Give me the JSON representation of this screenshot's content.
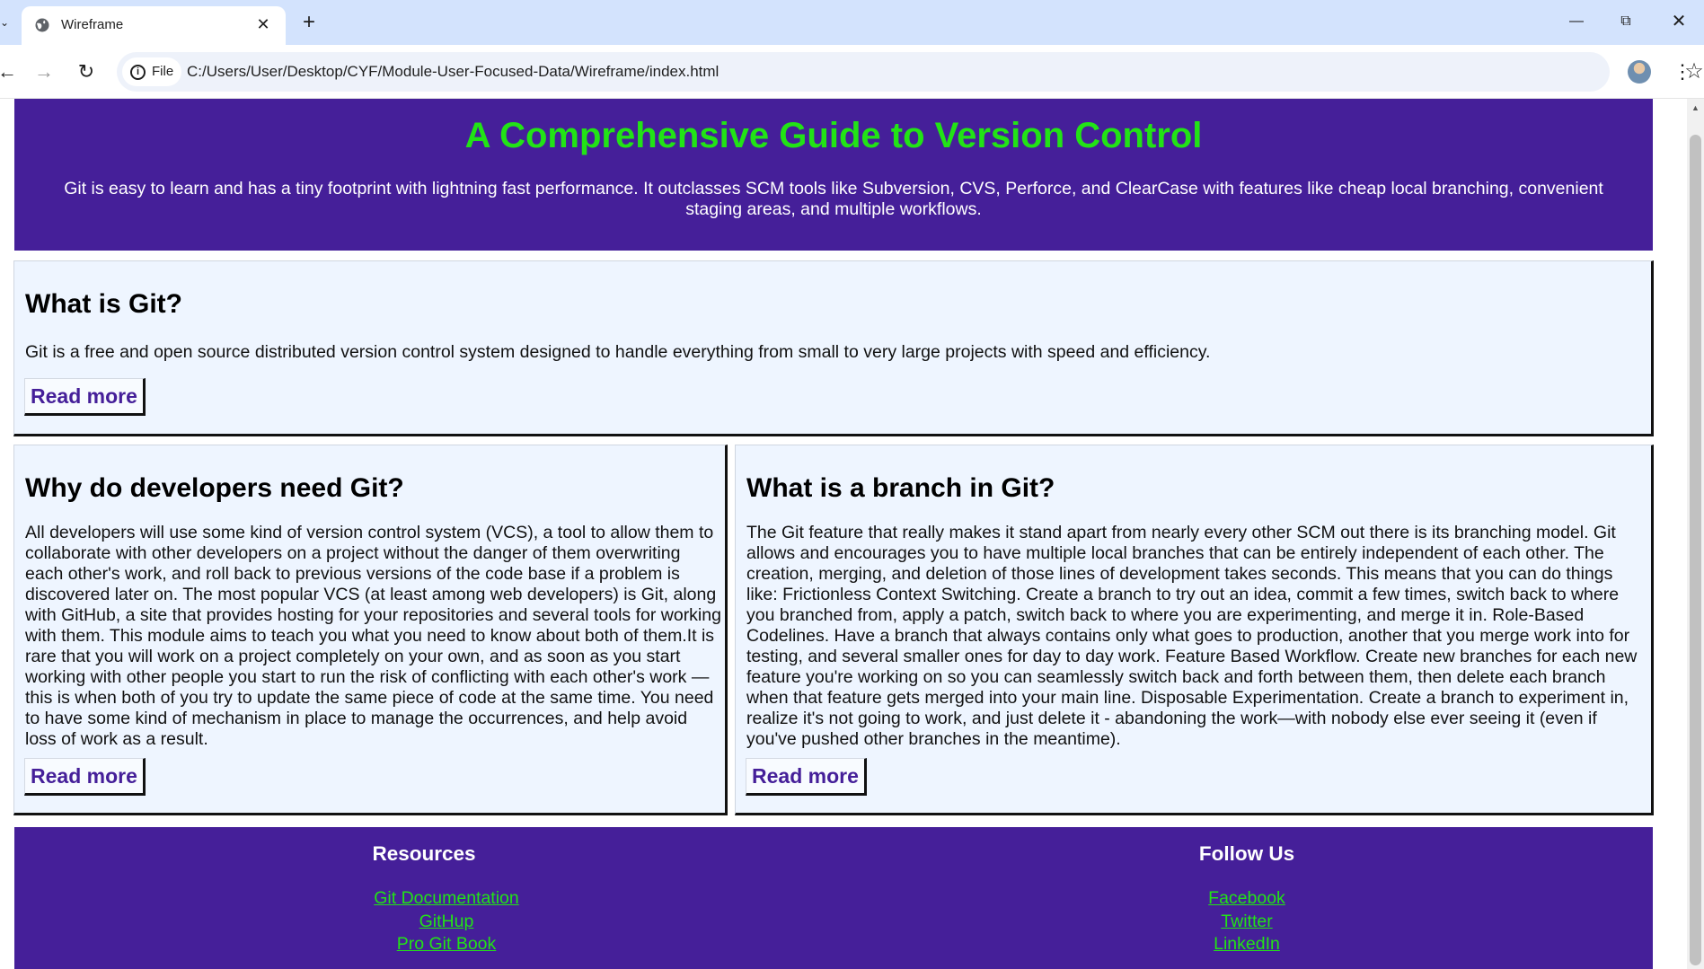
{
  "browser": {
    "tab_title": "Wireframe",
    "chip_label": "File",
    "url": "C:/Users/User/Desktop/CYF/Module-User-Focused-Data/Wireframe/index.html",
    "icons": [
      "chevron-down-icon",
      "globe-icon",
      "close-icon",
      "plus-icon",
      "minimize-icon",
      "maximize-icon",
      "window-close-icon",
      "back-arrow-icon",
      "forward-arrow-icon",
      "reload-icon",
      "info-icon",
      "star-icon",
      "avatar",
      "more-vert-icon"
    ]
  },
  "header": {
    "title": "A Comprehensive Guide to Version Control",
    "subtitle": "Git is easy to learn and has a tiny footprint with lightning fast performance. It outclasses SCM tools like Subversion, CVS, Perforce, and ClearCase with features like cheap local branching, convenient staging areas, and multiple workflows."
  },
  "articles": [
    {
      "heading": "What is Git?",
      "body": "Git is a free and open source distributed version control system designed to handle everything from small to very large projects with speed and efficiency.",
      "button": "Read more"
    },
    {
      "heading": "Why do developers need Git?",
      "body": "All developers will use some kind of version control system (VCS), a tool to allow them to collaborate with other developers on a project without the danger of them overwriting each other's work, and roll back to previous versions of the code base if a problem is discovered later on. The most popular VCS (at least among web developers) is Git, along with GitHub, a site that provides hosting for your repositories and several tools for working with them. This module aims to teach you what you need to know about both of them.It is rare that you will work on a project completely on your own, and as soon as you start working with other people you start to run the risk of conflicting with each other's work — this is when both of you try to update the same piece of code at the same time. You need to have some kind of mechanism in place to manage the occurrences, and help avoid loss of work as a result.",
      "button": "Read more"
    },
    {
      "heading": "What is a branch in Git?",
      "body": "The Git feature that really makes it stand apart from nearly every other SCM out there is its branching model. Git allows and encourages you to have multiple local branches that can be entirely independent of each other. The creation, merging, and deletion of those lines of development takes seconds. This means that you can do things like: Frictionless Context Switching. Create a branch to try out an idea, commit a few times, switch back to where you branched from, apply a patch, switch back to where you are experimenting, and merge it in. Role-Based Codelines. Have a branch that always contains only what goes to production, another that you merge work into for testing, and several smaller ones for day to day work. Feature Based Workflow. Create new branches for each new feature you're working on so you can seamlessly switch back and forth between them, then delete each branch when that feature gets merged into your main line. Disposable Experimentation. Create a branch to experiment in, realize it's not going to work, and just delete it - abandoning the work—with nobody else ever seeing it (even if you've pushed other branches in the meantime).",
      "button": "Read more"
    }
  ],
  "footer": {
    "resources": {
      "heading": "Resources",
      "links": [
        "Git Documentation",
        "GitHup",
        "Pro Git Book"
      ]
    },
    "follow": {
      "heading": "Follow Us",
      "links": [
        "Facebook",
        "Twitter",
        "LinkedIn"
      ]
    }
  },
  "colors": {
    "brand_purple": "#451f99",
    "accent_green": "#22e316",
    "card_background": "#eef5ff",
    "tabbar_background": "#d3e3fd"
  }
}
